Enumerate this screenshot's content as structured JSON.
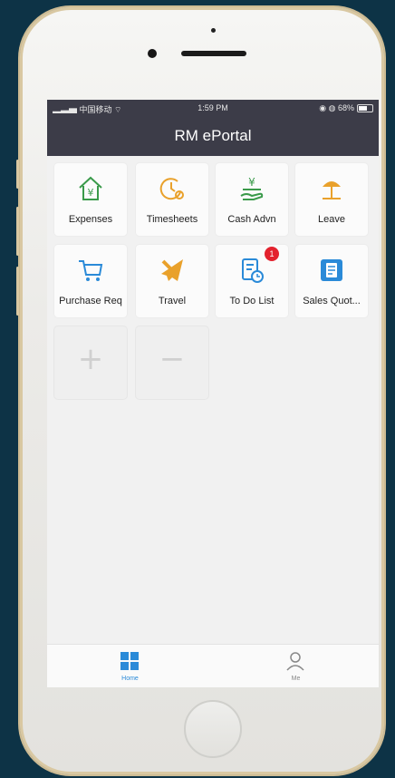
{
  "status": {
    "carrier": "中国移动",
    "time": "1:59 PM",
    "battery": "68%"
  },
  "header": {
    "title": "RM ePortal"
  },
  "apps": [
    {
      "label": "Expenses",
      "icon": "expenses-icon"
    },
    {
      "label": "Timesheets",
      "icon": "timesheets-icon"
    },
    {
      "label": "Cash Advn",
      "icon": "cash-advance-icon"
    },
    {
      "label": "Leave",
      "icon": "leave-icon"
    },
    {
      "label": "Purchase Req",
      "icon": "cart-icon"
    },
    {
      "label": "Travel",
      "icon": "airplane-icon"
    },
    {
      "label": "To Do List",
      "icon": "todo-icon",
      "badge": "1"
    },
    {
      "label": "Sales Quot...",
      "icon": "sales-quote-icon"
    }
  ],
  "actions": {
    "add": "+",
    "remove": "−"
  },
  "tabbar": {
    "home": "Home",
    "me": "Me",
    "active_color": "#2a8ad8"
  },
  "colors": {
    "accent_green": "#3a9a4a",
    "accent_orange": "#e9a12b",
    "accent_blue": "#2a8ad8",
    "badge": "#e3222e"
  }
}
